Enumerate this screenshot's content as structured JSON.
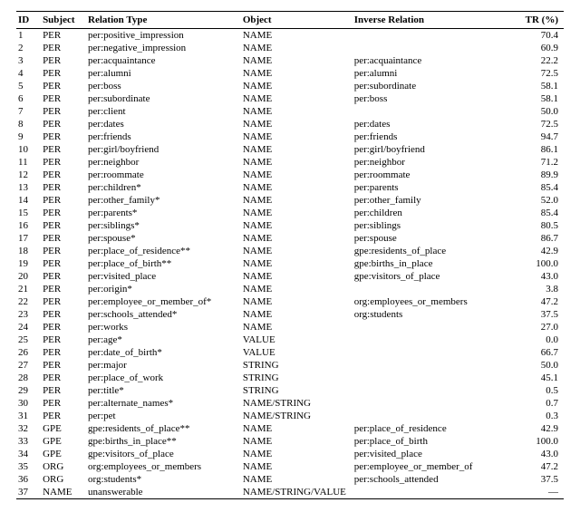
{
  "headers": {
    "id": "ID",
    "subject": "Subject",
    "relation": "Relation Type",
    "object": "Object",
    "inverse": "Inverse Relation",
    "tr": "TR (%)"
  },
  "rows": [
    {
      "id": "1",
      "subject": "PER",
      "relation": "per:positive_impression",
      "object": "NAME",
      "inverse": "",
      "tr": "70.4"
    },
    {
      "id": "2",
      "subject": "PER",
      "relation": "per:negative_impression",
      "object": "NAME",
      "inverse": "",
      "tr": "60.9"
    },
    {
      "id": "3",
      "subject": "PER",
      "relation": "per:acquaintance",
      "object": "NAME",
      "inverse": "per:acquaintance",
      "tr": "22.2"
    },
    {
      "id": "4",
      "subject": "PER",
      "relation": "per:alumni",
      "object": "NAME",
      "inverse": "per:alumni",
      "tr": "72.5"
    },
    {
      "id": "5",
      "subject": "PER",
      "relation": "per:boss",
      "object": "NAME",
      "inverse": "per:subordinate",
      "tr": "58.1"
    },
    {
      "id": "6",
      "subject": "PER",
      "relation": "per:subordinate",
      "object": "NAME",
      "inverse": "per:boss",
      "tr": "58.1"
    },
    {
      "id": "7",
      "subject": "PER",
      "relation": "per:client",
      "object": "NAME",
      "inverse": "",
      "tr": "50.0"
    },
    {
      "id": "8",
      "subject": "PER",
      "relation": "per:dates",
      "object": "NAME",
      "inverse": "per:dates",
      "tr": "72.5"
    },
    {
      "id": "9",
      "subject": "PER",
      "relation": "per:friends",
      "object": "NAME",
      "inverse": "per:friends",
      "tr": "94.7"
    },
    {
      "id": "10",
      "subject": "PER",
      "relation": "per:girl/boyfriend",
      "object": "NAME",
      "inverse": "per:girl/boyfriend",
      "tr": "86.1"
    },
    {
      "id": "11",
      "subject": "PER",
      "relation": "per:neighbor",
      "object": "NAME",
      "inverse": "per:neighbor",
      "tr": "71.2"
    },
    {
      "id": "12",
      "subject": "PER",
      "relation": "per:roommate",
      "object": "NAME",
      "inverse": "per:roommate",
      "tr": "89.9"
    },
    {
      "id": "13",
      "subject": "PER",
      "relation": "per:children*",
      "object": "NAME",
      "inverse": "per:parents",
      "tr": "85.4"
    },
    {
      "id": "14",
      "subject": "PER",
      "relation": "per:other_family*",
      "object": "NAME",
      "inverse": "per:other_family",
      "tr": "52.0"
    },
    {
      "id": "15",
      "subject": "PER",
      "relation": "per:parents*",
      "object": "NAME",
      "inverse": "per:children",
      "tr": "85.4"
    },
    {
      "id": "16",
      "subject": "PER",
      "relation": "per:siblings*",
      "object": "NAME",
      "inverse": "per:siblings",
      "tr": "80.5"
    },
    {
      "id": "17",
      "subject": "PER",
      "relation": "per:spouse*",
      "object": "NAME",
      "inverse": "per:spouse",
      "tr": "86.7"
    },
    {
      "id": "18",
      "subject": "PER",
      "relation": "per:place_of_residence**",
      "object": "NAME",
      "inverse": "gpe:residents_of_place",
      "tr": "42.9"
    },
    {
      "id": "19",
      "subject": "PER",
      "relation": "per:place_of_birth**",
      "object": "NAME",
      "inverse": "gpe:births_in_place",
      "tr": "100.0"
    },
    {
      "id": "20",
      "subject": "PER",
      "relation": "per:visited_place",
      "object": "NAME",
      "inverse": "gpe:visitors_of_place",
      "tr": "43.0"
    },
    {
      "id": "21",
      "subject": "PER",
      "relation": "per:origin*",
      "object": "NAME",
      "inverse": "",
      "tr": "3.8"
    },
    {
      "id": "22",
      "subject": "PER",
      "relation": "per:employee_or_member_of*",
      "object": "NAME",
      "inverse": "org:employees_or_members",
      "tr": "47.2"
    },
    {
      "id": "23",
      "subject": "PER",
      "relation": "per:schools_attended*",
      "object": "NAME",
      "inverse": "org:students",
      "tr": "37.5"
    },
    {
      "id": "24",
      "subject": "PER",
      "relation": "per:works",
      "object": "NAME",
      "inverse": "",
      "tr": "27.0"
    },
    {
      "id": "25",
      "subject": "PER",
      "relation": "per:age*",
      "object": "VALUE",
      "inverse": "",
      "tr": "0.0"
    },
    {
      "id": "26",
      "subject": "PER",
      "relation": "per:date_of_birth*",
      "object": "VALUE",
      "inverse": "",
      "tr": "66.7"
    },
    {
      "id": "27",
      "subject": "PER",
      "relation": "per:major",
      "object": "STRING",
      "inverse": "",
      "tr": "50.0"
    },
    {
      "id": "28",
      "subject": "PER",
      "relation": "per:place_of_work",
      "object": "STRING",
      "inverse": "",
      "tr": "45.1"
    },
    {
      "id": "29",
      "subject": "PER",
      "relation": "per:title*",
      "object": "STRING",
      "inverse": "",
      "tr": "0.5"
    },
    {
      "id": "30",
      "subject": "PER",
      "relation": "per:alternate_names*",
      "object": "NAME/STRING",
      "inverse": "",
      "tr": "0.7"
    },
    {
      "id": "31",
      "subject": "PER",
      "relation": "per:pet",
      "object": "NAME/STRING",
      "inverse": "",
      "tr": "0.3"
    },
    {
      "id": "32",
      "subject": "GPE",
      "relation": "gpe:residents_of_place**",
      "object": "NAME",
      "inverse": "per:place_of_residence",
      "tr": "42.9"
    },
    {
      "id": "33",
      "subject": "GPE",
      "relation": "gpe:births_in_place**",
      "object": "NAME",
      "inverse": "per:place_of_birth",
      "tr": "100.0"
    },
    {
      "id": "34",
      "subject": "GPE",
      "relation": "gpe:visitors_of_place",
      "object": "NAME",
      "inverse": "per:visited_place",
      "tr": "43.0"
    },
    {
      "id": "35",
      "subject": "ORG",
      "relation": "org:employees_or_members",
      "object": "NAME",
      "inverse": "per:employee_or_member_of",
      "tr": "47.2"
    },
    {
      "id": "36",
      "subject": "ORG",
      "relation": "org:students*",
      "object": "NAME",
      "inverse": "per:schools_attended",
      "tr": "37.5"
    },
    {
      "id": "37",
      "subject": "NAME",
      "relation": "unanswerable",
      "object": "NAME/STRING/VALUE",
      "inverse": "",
      "tr": "—"
    }
  ]
}
